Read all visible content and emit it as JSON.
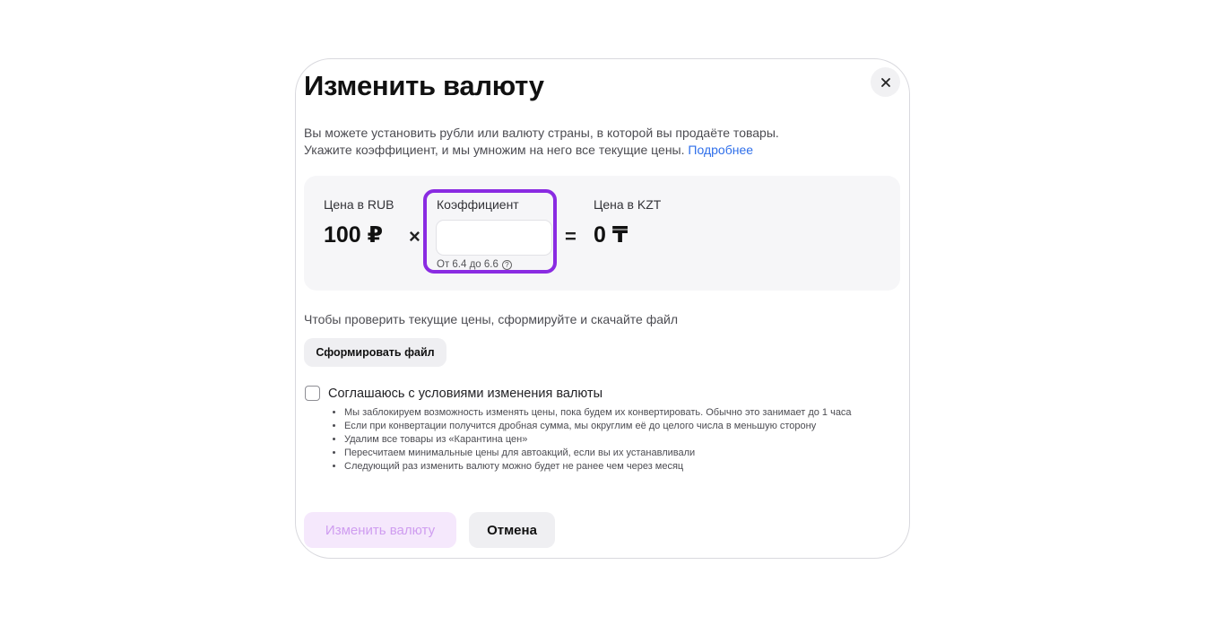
{
  "dialog": {
    "title": "Изменить валюту",
    "description_line1": "Вы можете установить рубли или валюту страны, в которой вы продаёте товары.",
    "description_line2": "Укажите коэффициент, и мы умножим на него все текущие цены.",
    "more_link": "Подробнее",
    "close_icon": "×"
  },
  "calculator": {
    "rub_label": "Цена в RUB",
    "rub_value": "100 ₽",
    "multiply_sign": "×",
    "coefficient_label": "Коэффициент",
    "coefficient_value": "",
    "coefficient_placeholder": "",
    "coefficient_hint": "От 6.4 до 6.6",
    "hint_icon": "?",
    "equals_sign": "=",
    "kzt_label": "Цена в KZT",
    "kzt_value": "0 ₸",
    "highlight_color": "#8a2be2"
  },
  "file": {
    "text": "Чтобы проверить текущие цены, сформируйте и скачайте файл",
    "button_label": "Сформировать файл"
  },
  "agreement": {
    "label": "Соглашаюсь с условиями изменения валюты",
    "checked": false,
    "items": [
      "Мы заблокируем возможность изменять цены, пока будем их конвертировать. Обычно это занимает до 1 часа",
      "Если при конвертации получится дробная сумма, мы округлим её до целого числа в меньшую сторону",
      "Удалим все товары из «Карантина цен»",
      "Пересчитаем минимальные цены для автоакций, если вы их устанавливали",
      "Следующий раз изменить валюту можно будет не ранее чем через месяц"
    ]
  },
  "actions": {
    "submit_label": "Изменить валюту",
    "cancel_label": "Отмена"
  }
}
